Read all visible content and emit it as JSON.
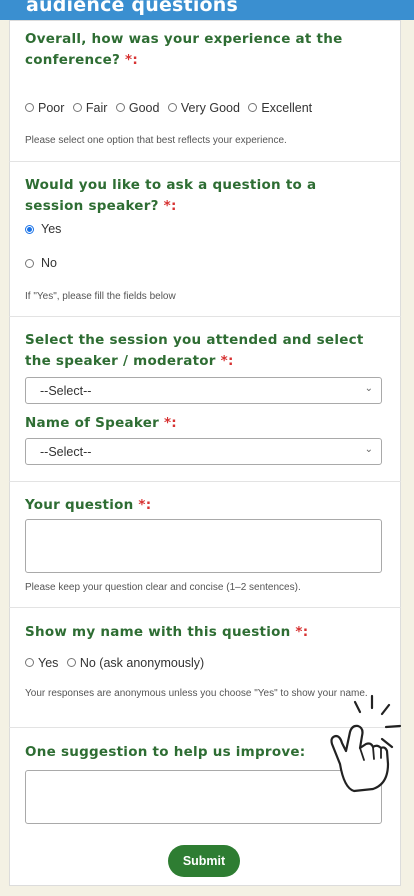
{
  "header": {
    "title": "audience questions"
  },
  "q1": {
    "label": "Overall, how was your experience at the conference?",
    "required_mark": "*:",
    "options": [
      "Poor",
      "Fair",
      "Good",
      "Very Good",
      "Excellent"
    ],
    "help": "Please select one option that best reflects your experience."
  },
  "q2": {
    "label": "Would you like to ask a question to a session speaker?",
    "required_mark": "*:",
    "options": [
      "Yes",
      "No"
    ],
    "selected": "Yes",
    "help": "If \"Yes\", please fill the fields below"
  },
  "q3": {
    "label": "Select the session you attended and select the speaker / moderator",
    "required_mark": "*:",
    "select_value": "--Select--"
  },
  "q4": {
    "label": "Name of Speaker",
    "required_mark": "*:",
    "select_value": "--Select--"
  },
  "q5": {
    "label": "Your question",
    "required_mark": "*:",
    "help": "Please keep your question clear and concise (1–2 sentences)."
  },
  "q6": {
    "label": "Show my name with this question",
    "required_mark": "*:",
    "options": [
      "Yes",
      "No (ask anonymously)"
    ],
    "help": "Your responses are anonymous unless you choose \"Yes\" to show your name."
  },
  "q7": {
    "label": "One suggestion to help us improve:"
  },
  "submit_label": "Submit",
  "colors": {
    "header": "#3a8fd0",
    "label": "#2e6d33",
    "required": "#d73232",
    "submit": "#2e7d32"
  }
}
